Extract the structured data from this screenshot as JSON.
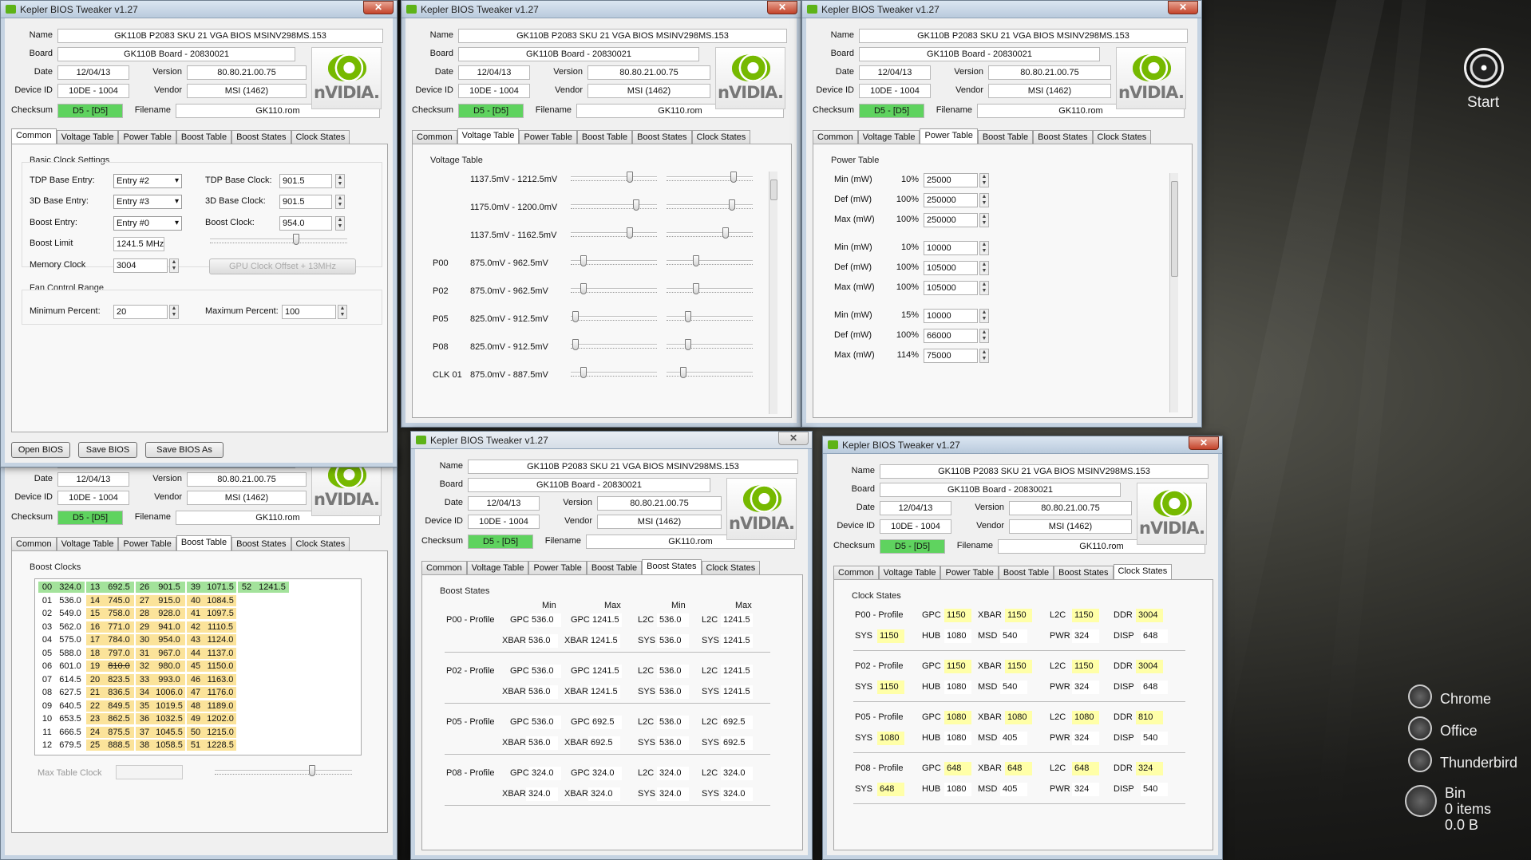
{
  "title": "Kepler BIOS Tweaker v1.27",
  "close_symbol": "✕",
  "info_labels": {
    "name": "Name",
    "board": "Board",
    "date": "Date",
    "version": "Version",
    "device_id": "Device ID",
    "vendor": "Vendor",
    "checksum": "Checksum",
    "filename": "Filename"
  },
  "info": {
    "name": "GK110B P2083 SKU 21 VGA BIOS MSINV298MS.153",
    "board": "GK110B Board - 20830021",
    "date": "12/04/13",
    "version": "80.80.21.00.75",
    "device_id": "10DE - 1004",
    "vendor": "MSI (1462)",
    "checksum": "D5 - [D5]",
    "filename": "GK110.rom"
  },
  "logo_text": "nVIDIA.",
  "tabs": [
    "Common",
    "Voltage Table",
    "Power Table",
    "Boost Table",
    "Boost States",
    "Clock States"
  ],
  "common": {
    "basic_group": "Basic Clock Settings",
    "tdp_base_entry_label": "TDP Base Entry:",
    "tdp_base_entry": "Entry #2",
    "base3d_entry_label": "3D Base Entry:",
    "base3d_entry": "Entry #3",
    "boost_entry_label": "Boost Entry:",
    "boost_entry": "Entry #0",
    "tdp_base_clock_label": "TDP Base Clock:",
    "tdp_base_clock": "901.5",
    "base3d_clock_label": "3D Base Clock:",
    "base3d_clock": "901.5",
    "boost_clock_label": "Boost Clock:",
    "boost_clock": "954.0",
    "boost_limit_label": "Boost Limit",
    "boost_limit": "1241.5 MHz",
    "memory_clock_label": "Memory Clock",
    "memory_clock": "3004",
    "gpu_offset": "GPU Clock Offset + 13MHz",
    "fan_group": "Fan Control Range",
    "min_percent_label": "Minimum Percent:",
    "min_percent": "20",
    "max_percent_label": "Maximum Percent:",
    "max_percent": "100"
  },
  "buttons": {
    "open": "Open BIOS",
    "save": "Save BIOS",
    "save_as": "Save BIOS As"
  },
  "voltage": {
    "group": "Voltage Table",
    "rows": [
      {
        "label": "",
        "range": "1137.5mV - 1212.5mV",
        "a": 0.7,
        "b": 0.8
      },
      {
        "label": "",
        "range": "1175.0mV - 1200.0mV",
        "a": 0.78,
        "b": 0.78
      },
      {
        "label": "",
        "range": "1137.5mV - 1162.5mV",
        "a": 0.7,
        "b": 0.7
      },
      {
        "label": "P00",
        "range": "875.0mV - 962.5mV",
        "a": 0.12,
        "b": 0.33
      },
      {
        "label": "P02",
        "range": "875.0mV - 962.5mV",
        "a": 0.12,
        "b": 0.33
      },
      {
        "label": "P05",
        "range": "825.0mV - 912.5mV",
        "a": 0.02,
        "b": 0.23
      },
      {
        "label": "P08",
        "range": "825.0mV - 912.5mV",
        "a": 0.02,
        "b": 0.23
      },
      {
        "label": "CLK 01",
        "range": "875.0mV - 887.5mV",
        "a": 0.12,
        "b": 0.17
      }
    ]
  },
  "power": {
    "group": "Power Table",
    "rows": [
      {
        "label": "Min (mW)",
        "pct": "10%",
        "val": "25000"
      },
      {
        "label": "Def (mW)",
        "pct": "100%",
        "val": "250000"
      },
      {
        "label": "Max (mW)",
        "pct": "100%",
        "val": "250000"
      },
      {
        "label": "Min (mW)",
        "pct": "10%",
        "val": "10000"
      },
      {
        "label": "Def (mW)",
        "pct": "100%",
        "val": "105000"
      },
      {
        "label": "Max (mW)",
        "pct": "100%",
        "val": "105000"
      },
      {
        "label": "Min (mW)",
        "pct": "15%",
        "val": "10000"
      },
      {
        "label": "Def (mW)",
        "pct": "100%",
        "val": "66000"
      },
      {
        "label": "Max (mW)",
        "pct": "114%",
        "val": "75000"
      }
    ]
  },
  "boost_table": {
    "group": "Boost Clocks",
    "max_table_clock_label": "Max Table Clock",
    "rows": [
      [
        "00",
        "324.0",
        "13",
        "692.5",
        "26",
        "901.5",
        "39",
        "1071.5",
        "52",
        "1241.5"
      ],
      [
        "01",
        "536.0",
        "14",
        "745.0",
        "27",
        "915.0",
        "40",
        "1084.5",
        "",
        ""
      ],
      [
        "02",
        "549.0",
        "15",
        "758.0",
        "28",
        "928.0",
        "41",
        "1097.5",
        "",
        ""
      ],
      [
        "03",
        "562.0",
        "16",
        "771.0",
        "29",
        "941.0",
        "42",
        "1110.5",
        "",
        ""
      ],
      [
        "04",
        "575.0",
        "17",
        "784.0",
        "30",
        "954.0",
        "43",
        "1124.0",
        "",
        ""
      ],
      [
        "05",
        "588.0",
        "18",
        "797.0",
        "31",
        "967.0",
        "44",
        "1137.0",
        "",
        ""
      ],
      [
        "06",
        "601.0",
        "19",
        "810.0",
        "32",
        "980.0",
        "45",
        "1150.0",
        "",
        ""
      ],
      [
        "07",
        "614.5",
        "20",
        "823.5",
        "33",
        "993.0",
        "46",
        "1163.0",
        "",
        ""
      ],
      [
        "08",
        "627.5",
        "21",
        "836.5",
        "34",
        "1006.0",
        "47",
        "1176.0",
        "",
        ""
      ],
      [
        "09",
        "640.5",
        "22",
        "849.5",
        "35",
        "1019.5",
        "48",
        "1189.0",
        "",
        ""
      ],
      [
        "10",
        "653.5",
        "23",
        "862.5",
        "36",
        "1032.5",
        "49",
        "1202.0",
        "",
        ""
      ],
      [
        "11",
        "666.5",
        "24",
        "875.5",
        "37",
        "1045.5",
        "50",
        "1215.0",
        "",
        ""
      ],
      [
        "12",
        "679.5",
        "25",
        "888.5",
        "38",
        "1058.5",
        "51",
        "1228.5",
        "",
        ""
      ]
    ]
  },
  "boost_states": {
    "group": "Boost States",
    "col_min": "Min",
    "col_max": "Max",
    "profiles": [
      {
        "name": "P00 - Profile",
        "gpc_min": "536.0",
        "gpc_max": "1241.5",
        "l2c_min": "536.0",
        "l2c_max": "1241.5",
        "xbar_min": "536.0",
        "xbar_max": "1241.5",
        "sys_min": "536.0",
        "sys_max": "1241.5"
      },
      {
        "name": "P02 - Profile",
        "gpc_min": "536.0",
        "gpc_max": "1241.5",
        "l2c_min": "536.0",
        "l2c_max": "1241.5",
        "xbar_min": "536.0",
        "xbar_max": "1241.5",
        "sys_min": "536.0",
        "sys_max": "1241.5"
      },
      {
        "name": "P05 - Profile",
        "gpc_min": "536.0",
        "gpc_max": "692.5",
        "l2c_min": "536.0",
        "l2c_max": "692.5",
        "xbar_min": "536.0",
        "xbar_max": "692.5",
        "sys_min": "536.0",
        "sys_max": "692.5"
      },
      {
        "name": "P08 - Profile",
        "gpc_min": "324.0",
        "gpc_max": "324.0",
        "l2c_min": "324.0",
        "l2c_max": "324.0",
        "xbar_min": "324.0",
        "xbar_max": "324.0",
        "sys_min": "324.0",
        "sys_max": "324.0"
      }
    ]
  },
  "clock_states": {
    "group": "Clock States",
    "profiles": [
      {
        "name": "P00 - Profile",
        "gpc": "1150",
        "xbar": "1150",
        "l2c": "1150",
        "ddr": "3004",
        "sys": "1150",
        "hub": "1080",
        "msd": "540",
        "pwr": "324",
        "disp": "648"
      },
      {
        "name": "P02 - Profile",
        "gpc": "1150",
        "xbar": "1150",
        "l2c": "1150",
        "ddr": "3004",
        "sys": "1150",
        "hub": "1080",
        "msd": "540",
        "pwr": "324",
        "disp": "648"
      },
      {
        "name": "P05 - Profile",
        "gpc": "1080",
        "xbar": "1080",
        "l2c": "1080",
        "ddr": "810",
        "sys": "1080",
        "hub": "1080",
        "msd": "405",
        "pwr": "324",
        "disp": "540"
      },
      {
        "name": "P08 - Profile",
        "gpc": "648",
        "xbar": "648",
        "l2c": "648",
        "ddr": "324",
        "sys": "648",
        "hub": "1080",
        "msd": "405",
        "pwr": "324",
        "disp": "540"
      }
    ]
  },
  "dock": {
    "start": "Start",
    "chrome": "Chrome",
    "office": "Office",
    "thunderbird": "Thunderbird",
    "bin": "Bin",
    "bin_items": "0 items",
    "bin_size": "0.0 B"
  }
}
